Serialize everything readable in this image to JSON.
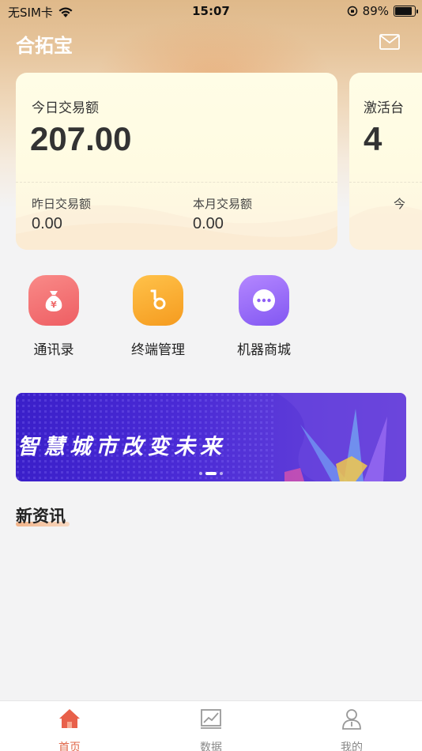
{
  "status_bar": {
    "carrier": "无SIM卡",
    "time": "15:07",
    "battery": "89%",
    "battery_level": 0.89
  },
  "header": {
    "title": "合拓宝",
    "mail_icon": "mail-icon"
  },
  "cards": [
    {
      "label": "今日交易额",
      "value": "207.00",
      "sub": [
        {
          "label": "昨日交易额",
          "value": "0.00"
        },
        {
          "label": "本月交易额",
          "value": "0.00"
        }
      ]
    },
    {
      "label": "激活台",
      "value": "4",
      "sub_label": "今"
    }
  ],
  "menu": [
    {
      "label": "通讯录",
      "icon": "money-bag-icon",
      "color": "#f06b6b"
    },
    {
      "label": "终端管理",
      "icon": "key-icon",
      "color": "#f5a623"
    },
    {
      "label": "机器商城",
      "icon": "more-dots-icon",
      "color": "#8f5ff5"
    }
  ],
  "banner": {
    "text": "智慧城市改变未来",
    "active_index": 0,
    "count": 2
  },
  "news": {
    "title": "新资讯"
  },
  "tabs": [
    {
      "label": "首页",
      "icon": "home-icon",
      "active": true
    },
    {
      "label": "数据",
      "icon": "chart-icon",
      "active": false
    },
    {
      "label": "我的",
      "icon": "user-icon",
      "active": false
    }
  ],
  "colors": {
    "accent": "#e0684a",
    "header_gold": "#dfb98a",
    "banner_purple": "#4b2bd6"
  }
}
